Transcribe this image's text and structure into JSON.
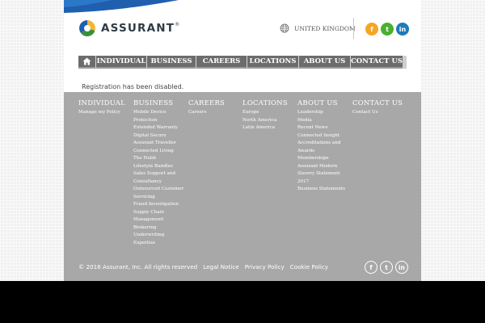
{
  "brand": {
    "name": "ASSURANT",
    "mark": "®"
  },
  "header": {
    "region_icon": "globe-icon",
    "region_label": "UNITED KINGDOM",
    "social": [
      {
        "name": "facebook",
        "glyph": "f",
        "color": "#f5a623"
      },
      {
        "name": "twitter",
        "glyph": "t",
        "color": "#4ab02f"
      },
      {
        "name": "linkedin",
        "glyph": "in",
        "color": "#1e7ab8"
      }
    ]
  },
  "nav": {
    "home_icon": "home-icon",
    "items": [
      "INDIVIDUAL",
      "BUSINESS",
      "CAREERS",
      "LOCATIONS",
      "ABOUT US",
      "CONTACT US"
    ]
  },
  "notice": "Registration has been disabled.",
  "footer": {
    "columns": [
      {
        "heading": "INDIVIDUAL",
        "links": [
          "Manage my Policy"
        ]
      },
      {
        "heading": "BUSINESS",
        "links": [
          "Mobile Device Protection",
          "Extended Warranty",
          "Digital Secure",
          "Assurant Traveller",
          "Connected Living",
          "The Hubb",
          "Lifestyle Bundles",
          "Sales Support and Consultancy",
          "Outsourced Customer Servicing",
          "Fraud Investigation",
          "Supply Chain Management",
          "Brokering",
          "Underwriting Expertise"
        ]
      },
      {
        "heading": "CAREERS",
        "links": [
          "Careers"
        ]
      },
      {
        "heading": "LOCATIONS",
        "links": [
          "Europe",
          "North America",
          "Latin America"
        ]
      },
      {
        "heading": "ABOUT US",
        "links": [
          "Leadership",
          "Media",
          "Recent News",
          "Connected Insight",
          "Accreditations and Awards",
          "Memberships",
          "Assurant Modern Slavery Statement 2017",
          "Business Statements"
        ]
      },
      {
        "heading": "CONTACT US",
        "links": [
          "Contact Us"
        ]
      }
    ],
    "dots": "· ·",
    "copyright": "© 2016 Assurant, Inc. All rights reserved",
    "legal": [
      "Legal Notice",
      "Privacy Policy",
      "Cookie Policy"
    ],
    "social": [
      {
        "name": "facebook",
        "glyph": "f"
      },
      {
        "name": "twitter",
        "glyph": "t"
      },
      {
        "name": "linkedin",
        "glyph": "in"
      }
    ]
  }
}
